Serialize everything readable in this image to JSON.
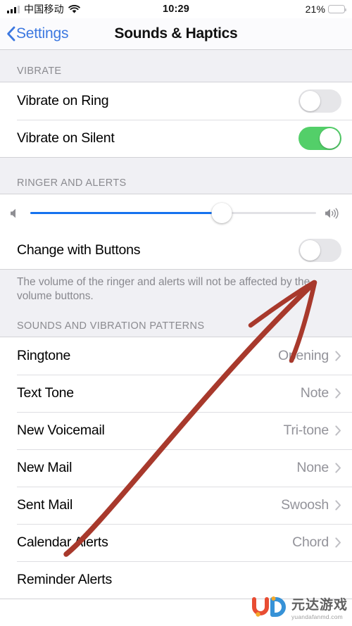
{
  "status_bar": {
    "carrier": "中国移动",
    "signal_icon": "cellular-bars-icon",
    "wifi_icon": "wifi-icon",
    "time": "10:29",
    "battery_percent": "21%",
    "battery_level": 21,
    "battery_color": "#fdd535"
  },
  "nav": {
    "back_label": "Settings",
    "back_icon": "chevron-left-icon",
    "title": "Sounds & Haptics",
    "tint_color": "#3c78e0"
  },
  "sections": [
    {
      "header": "VIBRATE",
      "rows": [
        {
          "label": "Vibrate on Ring",
          "type": "toggle",
          "on": false
        },
        {
          "label": "Vibrate on Silent",
          "type": "toggle",
          "on": true
        }
      ]
    },
    {
      "header": "RINGER AND ALERTS",
      "rows": [
        {
          "label": "Ringer Volume",
          "type": "slider",
          "value": 67,
          "left_icon": "speaker-low-icon",
          "right_icon": "speaker-high-icon",
          "fill_color": "#1572ef"
        },
        {
          "label": "Change with Buttons",
          "type": "toggle",
          "on": false
        }
      ],
      "footnote": "The volume of the ringer and alerts will not be affected by the volume buttons."
    },
    {
      "header": "SOUNDS AND VIBRATION PATTERNS",
      "rows": [
        {
          "label": "Ringtone",
          "type": "value",
          "value": "Opening"
        },
        {
          "label": "Text Tone",
          "type": "value",
          "value": "Note"
        },
        {
          "label": "New Voicemail",
          "type": "value",
          "value": "Tri-tone"
        },
        {
          "label": "New Mail",
          "type": "value",
          "value": "None"
        },
        {
          "label": "Sent Mail",
          "type": "value",
          "value": "Swoosh"
        },
        {
          "label": "Calendar Alerts",
          "type": "value",
          "value": "Chord"
        },
        {
          "label": "Reminder Alerts",
          "type": "value",
          "value": ""
        }
      ]
    }
  ],
  "annotation": {
    "type": "hand-drawn-arrow",
    "color": "#a8392c",
    "points_at": "Change with Buttons toggle"
  },
  "watermark": {
    "brand_cn": "元达游戏",
    "url": "yuandafanmd.com",
    "logo_colors": [
      "#e8462b",
      "#2f8ed6",
      "#f5a623"
    ]
  }
}
